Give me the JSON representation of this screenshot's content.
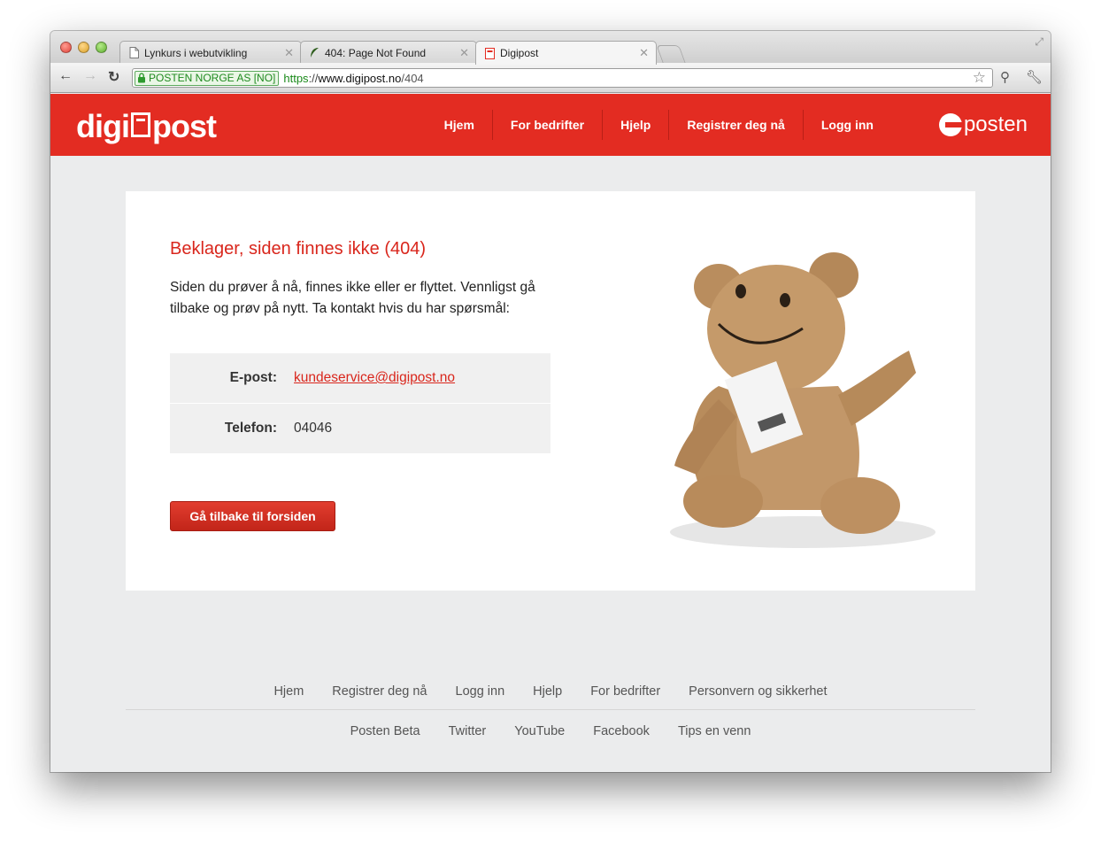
{
  "browser": {
    "tabs": [
      {
        "title": "Lynkurs i webutvikling",
        "icon": "document-icon"
      },
      {
        "title": "404: Page Not Found",
        "icon": "leaf-icon"
      },
      {
        "title": "Digipost",
        "icon": "digipost-favicon"
      }
    ],
    "active_tab": 2,
    "ev_certificate": "POSTEN NORGE AS [NO]",
    "url": {
      "scheme": "https",
      "separator": "://",
      "host": "www.digipost.no",
      "path": "/404"
    }
  },
  "site": {
    "brand_left": "digi",
    "brand_right": "post",
    "nav": [
      "Hjem",
      "For bedrifter",
      "Hjelp",
      "Registrer deg nå",
      "Logg inn"
    ],
    "partner_logo": "posten",
    "accent_color": "#e32c22"
  },
  "error": {
    "title": "Beklager, siden finnes ikke (404)",
    "description": "Siden du prøver å nå, finnes ikke eller er flyttet. Vennligst gå tilbake og prøv på nytt. Ta kontakt hvis du har spørsmål:",
    "contacts": [
      {
        "label": "E-post:",
        "value": "kundeservice@digipost.no"
      },
      {
        "label": "Telefon:",
        "value": "04046"
      }
    ],
    "back_button": "Gå tilbake til forsiden"
  },
  "footer": {
    "row1": [
      "Hjem",
      "Registrer deg nå",
      "Logg inn",
      "Hjelp",
      "For bedrifter",
      "Personvern og sikkerhet"
    ],
    "row2": [
      "Posten Beta",
      "Twitter",
      "YouTube",
      "Facebook",
      "Tips en venn"
    ]
  }
}
